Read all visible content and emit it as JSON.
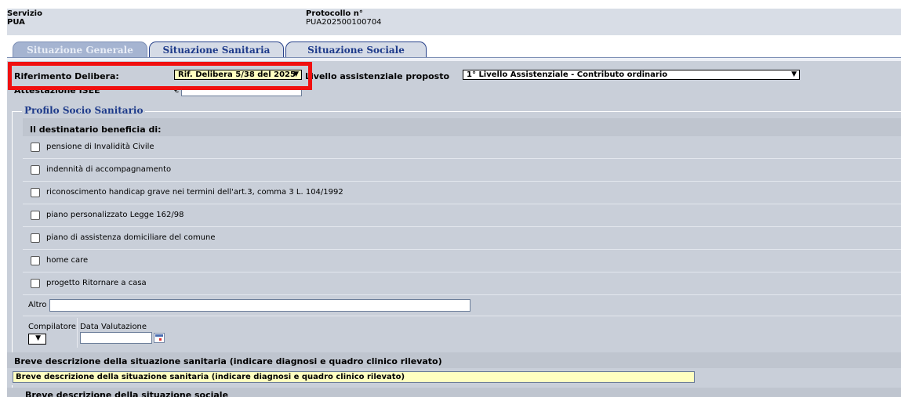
{
  "header": {
    "servizio_label": "Servizio",
    "servizio_value": "PUA",
    "protocollo_label": "Protocollo n°",
    "protocollo_value": "PUA202500100704"
  },
  "tabs": [
    {
      "label": "Situazione Generale",
      "active": true
    },
    {
      "label": "Situazione Sanitaria",
      "active": false
    },
    {
      "label": "Situazione Sociale",
      "active": false
    }
  ],
  "form": {
    "riferimento_label": "Riferimento Delibera:",
    "riferimento_value": "Rif. Delibera 5/38 del 2025",
    "livello_label": "Livello assistenziale proposto",
    "livello_value": "1° Livello Assistenziale - Contributo ordinario",
    "isee_label": "Attestazione ISEE",
    "isee_currency": "€",
    "isee_value": ""
  },
  "profilo": {
    "legend": "Profilo Socio Sanitario",
    "subheader": "Il destinatario beneficia di:",
    "items": [
      "pensione di Invalidità Civile",
      "indennità di accompagnamento",
      "riconoscimento handicap grave nei termini dell'art.3, comma 3 L. 104/1992",
      "piano personalizzato Legge 162/98",
      "piano di assistenza domiciliare del comune",
      "home care",
      "progetto Ritornare a casa"
    ],
    "altro_label": "Altro",
    "altro_value": "",
    "compilatore_label": "Compilatore",
    "data_valutazione_label": "Data Valutazione",
    "data_valutazione_value": ""
  },
  "sanitaria": {
    "header": "Breve descrizione della situazione sanitaria (indicare diagnosi e quadro clinico rilevato)",
    "value": "Breve descrizione della situazione sanitaria (indicare diagnosi e quadro clinico rilevato)"
  },
  "sociale": {
    "header": "Breve descrizione della situazione sociale"
  },
  "colors": {
    "highlight": "#f01010",
    "tab_text": "#1d3a8a",
    "yellow_field": "#ffffc0",
    "panel": "#c9cfd9"
  }
}
